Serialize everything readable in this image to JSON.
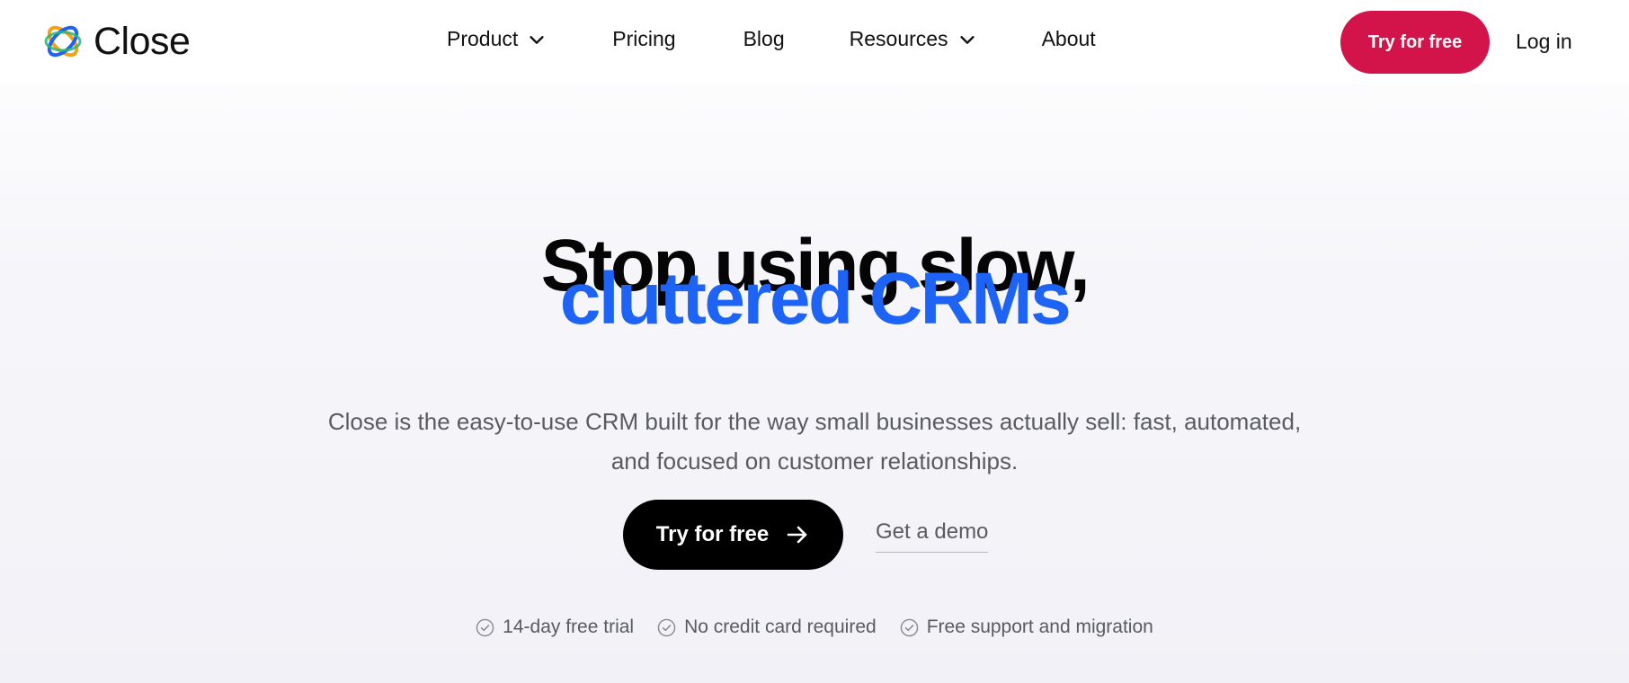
{
  "brand": {
    "name": "Close",
    "logo_icon": "close-logo-icon",
    "accent_color": "#1d63f6",
    "cta_color": "#d3144a"
  },
  "nav": {
    "items": [
      {
        "label": "Product",
        "icon": "chevron-down-icon"
      },
      {
        "label": "Pricing"
      },
      {
        "label": "Blog"
      },
      {
        "label": "Resources",
        "icon": "chevron-down-icon"
      },
      {
        "label": "About"
      }
    ],
    "cta_label": "Try for free",
    "login_label": "Log in"
  },
  "hero": {
    "title_line1": "Stop using slow,",
    "title_line2": "cluttered CRMs",
    "subtitle": "Close is the easy-to-use CRM built for the way small businesses actually sell: fast, automated, and focused on customer relationships.",
    "primary_cta": "Try for free",
    "primary_cta_icon": "arrow-right-icon",
    "secondary_cta": "Get a demo"
  },
  "features": [
    {
      "label": "14-day free trial",
      "icon": "check-circle-icon"
    },
    {
      "label": "No credit card required",
      "icon": "check-circle-icon"
    },
    {
      "label": "Free support and migration",
      "icon": "check-circle-icon"
    }
  ]
}
